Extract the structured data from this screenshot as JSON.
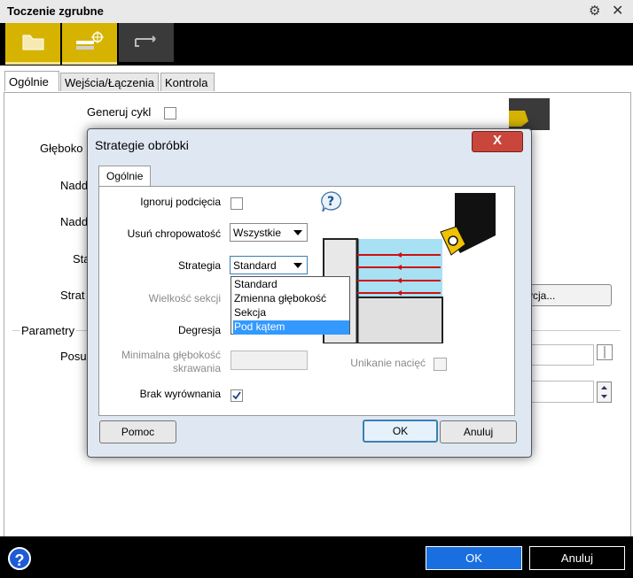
{
  "window": {
    "title": "Toczenie zgrubne"
  },
  "outer_tabs": [
    "Ogólnie",
    "Wejścia/Łączenia",
    "Kontrola"
  ],
  "outer_form": {
    "generate_cycle_label": "Generuj cykl",
    "depth_label_fragment": "Głęboko",
    "allowance1_fragment": "Nadd",
    "allowance2_fragment": "Nadd",
    "strategy_fragment": "Sta",
    "strategy2_fragment": "Strat",
    "position_button_fragment": "ycja...",
    "parameters_group": "Parametry",
    "feed_fragment": "Posu"
  },
  "outer_buttons": {
    "help": "?",
    "ok": "OK",
    "cancel": "Anuluj"
  },
  "dialog": {
    "title": "Strategie obróbki",
    "close": "X",
    "tab": "Ogólnie",
    "ignore_undercuts_label": "Ignoruj podcięcia",
    "ignore_undercuts_checked": false,
    "remove_roughness_label": "Usuń chropowatość",
    "remove_roughness_value": "Wszystkie",
    "strategy_label": "Strategia",
    "strategy_value": "Standard",
    "strategy_options": [
      "Standard",
      "Zmienna głębokość",
      "Sekcja",
      "Pod kątem"
    ],
    "strategy_highlighted": "Pod kątem",
    "section_size_label": "Wielkość sekcji",
    "degression_label": "Degresja",
    "min_cut_depth_label_1": "Minimalna głębokość",
    "min_cut_depth_label_2": "skrawania",
    "avoid_notches_label": "Unikanie nacięć",
    "no_alignment_label": "Brak wyrównania",
    "no_alignment_checked": true,
    "help_button": "Pomoc",
    "ok_button": "OK",
    "cancel_button": "Anuluj"
  },
  "colors": {
    "accent_yellow": "#d6b300",
    "ok_blue": "#1a6fe0",
    "highlight": "#3399ff",
    "cut_lines": "#d01010",
    "material_blue": "#a8e0f4"
  }
}
